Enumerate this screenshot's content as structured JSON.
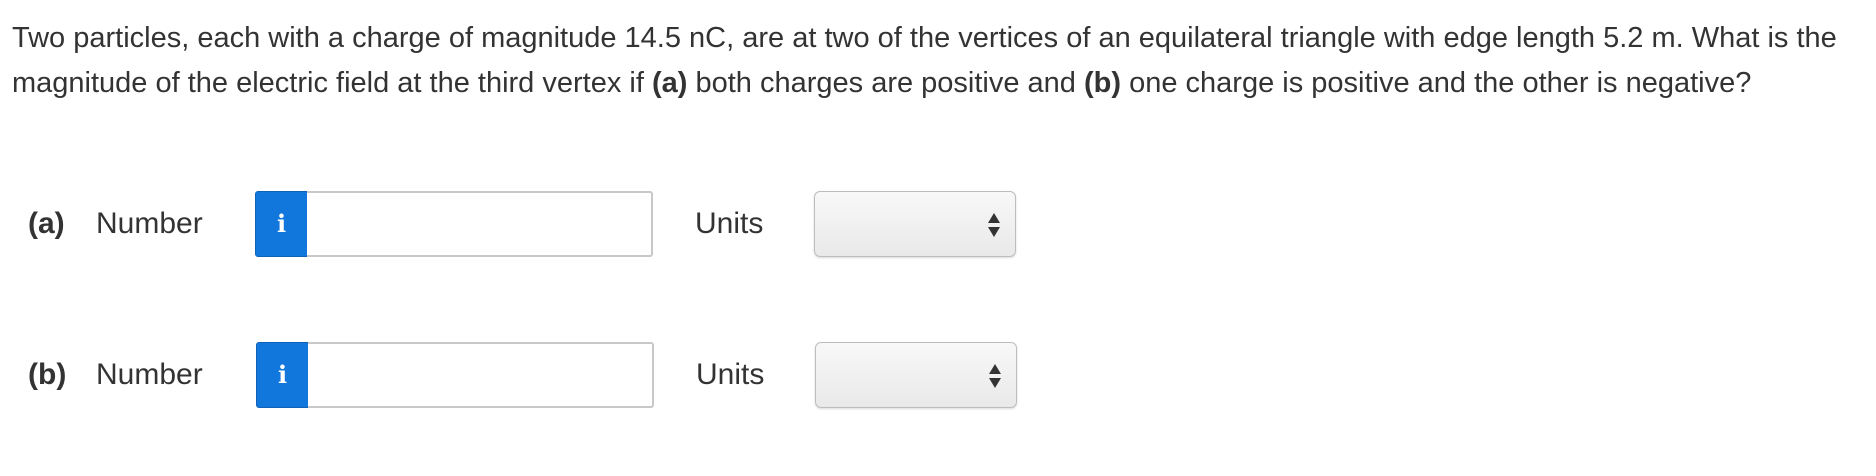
{
  "question": {
    "intro": "Two particles, each with a charge of magnitude 14.5 nC, are at two of the vertices of an equilateral triangle with edge length 5.2 m. What is the magnitude of the electric field at the third vertex if ",
    "part_a_marker": "(a)",
    "part_a_text": " both charges are positive and ",
    "part_b_marker": "(b)",
    "part_b_text": " one charge is positive and the other is negative?"
  },
  "answers": [
    {
      "part_label": "(a)",
      "number_label": "Number",
      "info_glyph": "i",
      "number_value": "",
      "units_label": "Units",
      "units_selected": ""
    },
    {
      "part_label": "(b)",
      "number_label": "Number",
      "info_glyph": "i",
      "number_value": "",
      "units_label": "Units",
      "units_selected": ""
    }
  ],
  "icons": {
    "info": "info-icon",
    "select_arrows": "up-down-arrows-icon"
  },
  "colors": {
    "info_button": "#1177dd",
    "text": "#333333",
    "input_border": "#c8c8c8"
  }
}
